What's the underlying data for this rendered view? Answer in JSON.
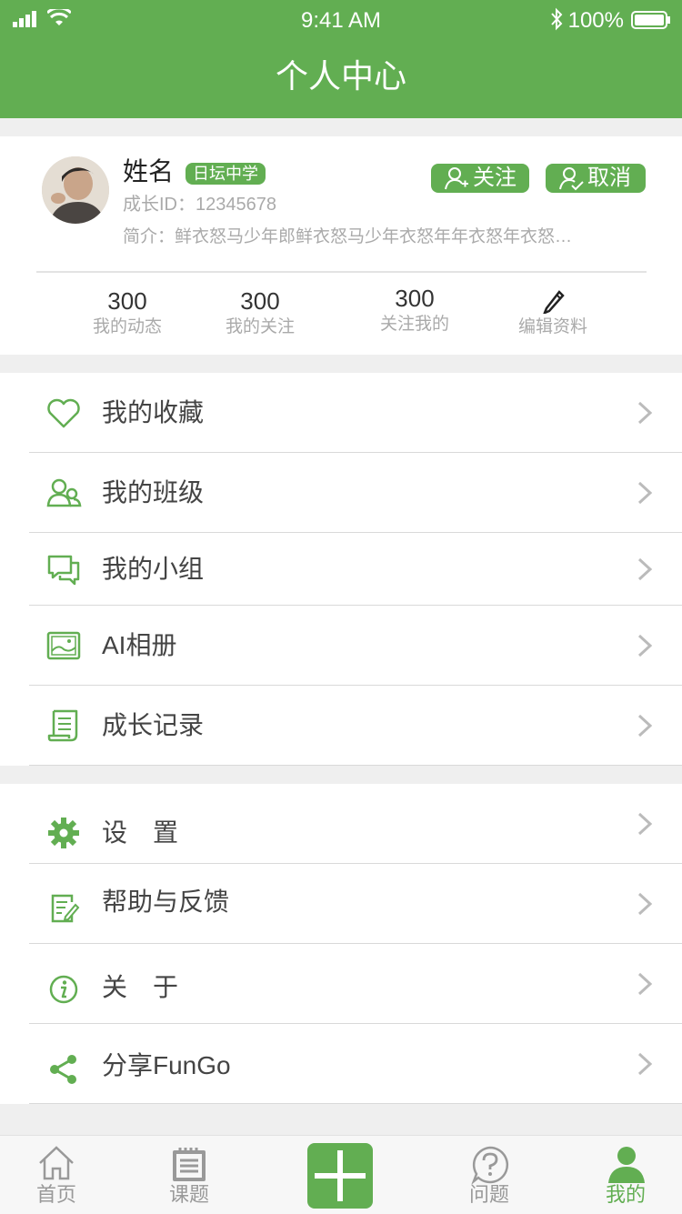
{
  "status_bar": {
    "time": "9:41 AM",
    "battery": "100%"
  },
  "header": {
    "title": "个人中心"
  },
  "profile": {
    "name": "姓名",
    "school": "日坛中学",
    "growth_id": "成长ID：12345678",
    "bio": "简介：鲜衣怒马少年郎鲜衣怒马少年衣怒年年衣怒年衣怒马少年郎",
    "follow_label": "关注",
    "cancel_label": "取消",
    "stats": [
      {
        "value": "300",
        "label": "我的动态"
      },
      {
        "value": "300",
        "label": "我的关注"
      },
      {
        "value": "300",
        "label": "关注我的"
      }
    ],
    "edit_label": "编辑资料"
  },
  "menu_group_1": [
    {
      "label": "我的收藏",
      "icon": "heart-icon"
    },
    {
      "label": "我的班级",
      "icon": "users-icon"
    },
    {
      "label": "我的小组",
      "icon": "chat-icon"
    },
    {
      "label": "AI相册",
      "icon": "photo-icon"
    },
    {
      "label": "成长记录",
      "icon": "scroll-icon"
    }
  ],
  "menu_group_2": [
    {
      "label": "设　置",
      "icon": "gear-icon"
    },
    {
      "label": "帮助与反馈",
      "icon": "feedback-icon"
    },
    {
      "label": "关　于",
      "icon": "info-icon"
    },
    {
      "label": "分享FunGo",
      "icon": "share-icon"
    }
  ],
  "tabbar": [
    {
      "label": "首页",
      "icon": "home-icon"
    },
    {
      "label": "课题",
      "icon": "notebook-icon"
    },
    {
      "label": "",
      "icon": "plus-icon"
    },
    {
      "label": "问题",
      "icon": "question-icon"
    },
    {
      "label": "我的",
      "icon": "person-icon"
    }
  ],
  "colors": {
    "accent": "#62ae52",
    "muted": "#aaaaaa"
  }
}
